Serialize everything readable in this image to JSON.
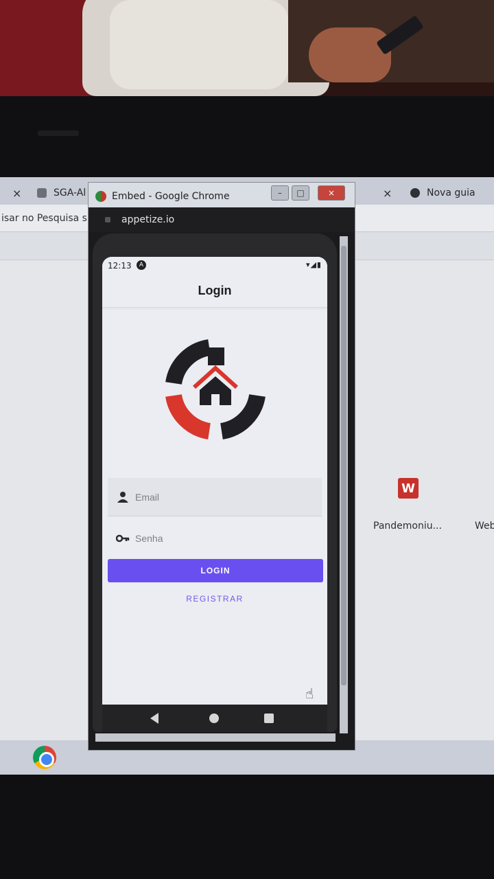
{
  "browser": {
    "tabs": [
      {
        "label": "SGA-Al",
        "icon": "puzzle-icon"
      },
      {
        "label": "Nova guia",
        "icon": "globe-icon"
      }
    ],
    "close_glyph": "×",
    "address_text": "isar no Pesquisa s",
    "shortcuts": [
      {
        "label": "Pandemoniu...",
        "icon": "W"
      },
      {
        "label": "Web"
      }
    ]
  },
  "embed_window": {
    "title": "Embed - Google Chrome",
    "url": "appetize.io",
    "window_buttons": {
      "minimize": "–",
      "maximize": "□",
      "close": "×"
    }
  },
  "phone": {
    "status_bar": {
      "time": "12:13",
      "badge": "A",
      "icons": "▾◢▮"
    },
    "app_bar_title": "Login",
    "logo_colors": {
      "dark": "#1f1f24",
      "accent": "#d9362c"
    },
    "email_placeholder": "Email",
    "password_placeholder": "Senha",
    "login_button": "LOGIN",
    "register_button": "REGISTRAR",
    "accent_color": "#6a4ff0"
  },
  "cursor_glyph": "☝"
}
